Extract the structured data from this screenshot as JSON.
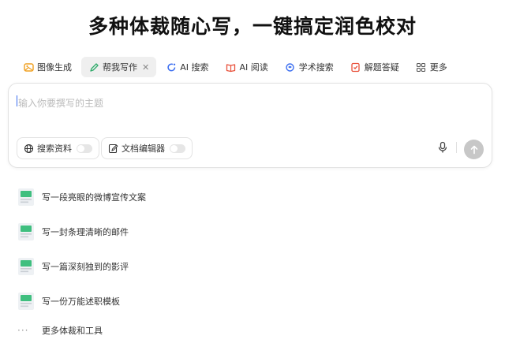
{
  "header": {
    "title": "多种体裁随心写，一键搞定润色校对"
  },
  "tabs": [
    {
      "label": "图像生成",
      "icon": "image-gen-icon"
    },
    {
      "label": "帮我写作",
      "icon": "pen-icon",
      "active": true
    },
    {
      "label": "AI 搜索",
      "icon": "ai-search-icon"
    },
    {
      "label": "AI 阅读",
      "icon": "book-icon"
    },
    {
      "label": "学术搜索",
      "icon": "academic-icon"
    },
    {
      "label": "解题答疑",
      "icon": "exam-icon"
    },
    {
      "label": "更多",
      "icon": "grid-more-icon"
    }
  ],
  "composer": {
    "placeholder": "输入你要撰写的主题",
    "search_toggle_label": "搜索资料",
    "search_toggle_on": false,
    "editor_toggle_label": "文档编辑器",
    "editor_toggle_on": false
  },
  "suggestions": [
    {
      "label": "写一段亮眼的微博宣传文案"
    },
    {
      "label": "写一封条理清晰的邮件"
    },
    {
      "label": "写一篇深刻独到的影评"
    },
    {
      "label": "写一份万能述职模板"
    }
  ],
  "more_label": "更多体裁和工具",
  "colors": {
    "accent_blue": "#3a6df0",
    "send_button": "#c7c7c7",
    "thumb_green": "#3fbf7f"
  }
}
